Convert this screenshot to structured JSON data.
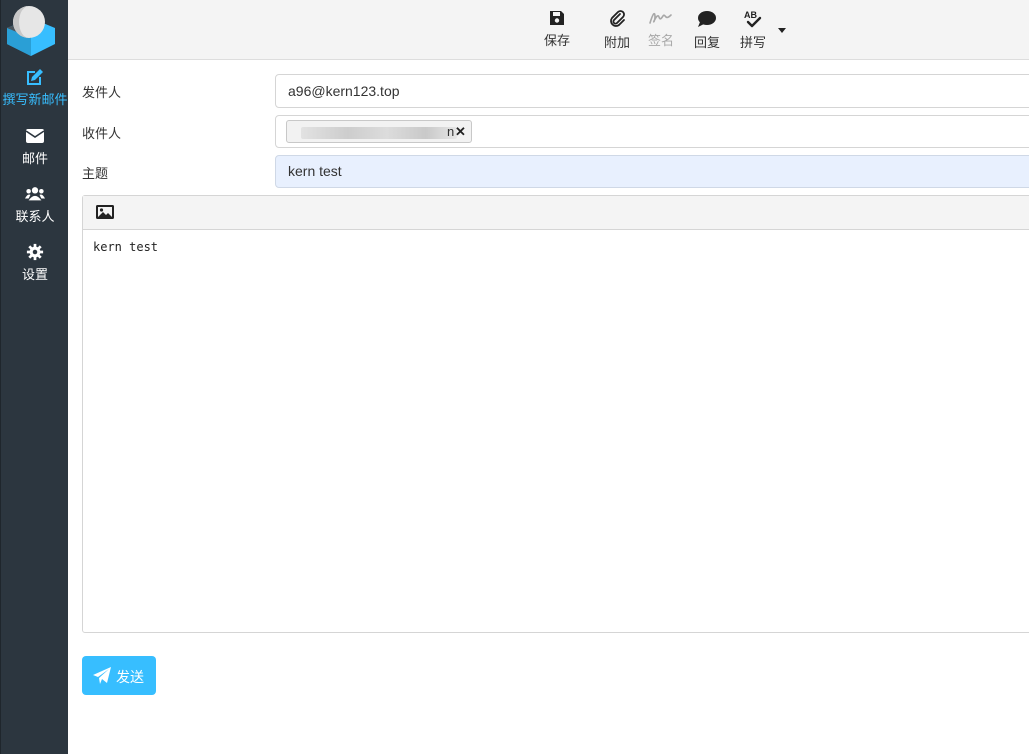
{
  "sidebar": {
    "items": [
      {
        "label": "撰写新邮件",
        "icon": "edit-icon",
        "active": true
      },
      {
        "label": "邮件",
        "icon": "envelope-icon"
      },
      {
        "label": "联系人",
        "icon": "users-icon"
      },
      {
        "label": "设置",
        "icon": "gear-icon"
      }
    ]
  },
  "toolbar": {
    "save_label": "保存",
    "attach_label": "附加",
    "signature_label": "签名",
    "reply_label": "回复",
    "spell_label": "拼写"
  },
  "form": {
    "from_label": "发件人",
    "from_value": "a96@kern123.top",
    "to_label": "收件人",
    "to_recipient_tail": "n",
    "subject_label": "主题",
    "subject_value": "kern test"
  },
  "editor": {
    "body": "kern test"
  },
  "send_label": "发送",
  "colors": {
    "accent": "#37beff",
    "sidebar_bg": "#2c363f",
    "toolbar_bg": "#f4f4f4"
  }
}
